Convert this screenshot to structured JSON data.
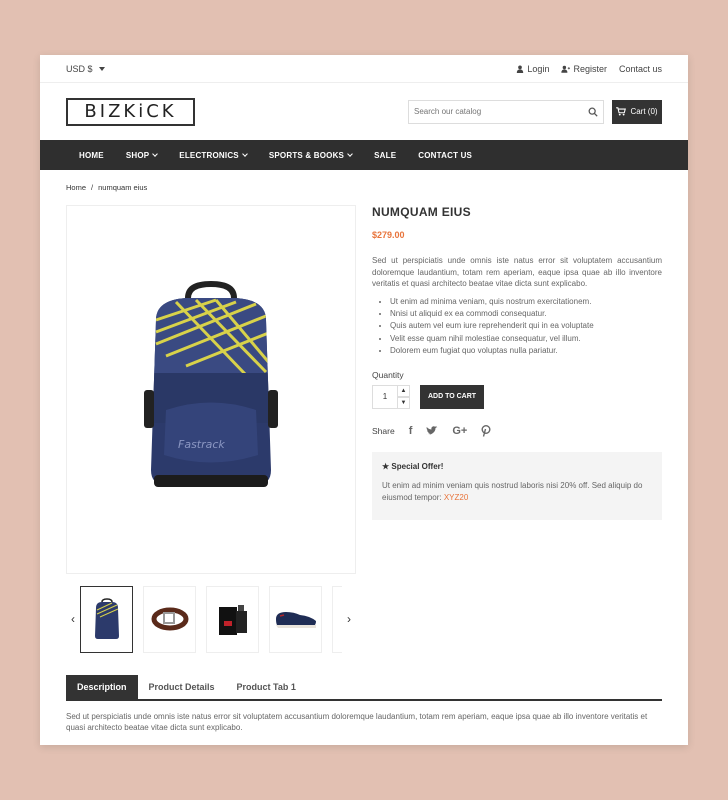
{
  "topbar": {
    "currency": "USD $",
    "login": "Login",
    "register": "Register",
    "contact": "Contact us"
  },
  "header": {
    "logo": "BIZKiCK",
    "search_placeholder": "Search our catalog",
    "cart": "Cart (0)"
  },
  "nav": {
    "items": [
      {
        "label": "HOME",
        "dropdown": false
      },
      {
        "label": "SHOP",
        "dropdown": true
      },
      {
        "label": "ELECTRONICS",
        "dropdown": true
      },
      {
        "label": "SPORTS & BOOKS",
        "dropdown": true
      },
      {
        "label": "SALE",
        "dropdown": false
      },
      {
        "label": "CONTACT US",
        "dropdown": false
      }
    ]
  },
  "breadcrumb": {
    "home": "Home",
    "separator": "/",
    "current": "numquam eius"
  },
  "product": {
    "title": "NUMQUAM EIUS",
    "price": "$279.00",
    "description": "Sed ut perspiciatis unde omnis iste natus error sit voluptatem accusantium doloremque laudantium, totam rem aperiam, eaque ipsa quae ab illo inventore veritatis et quasi architecto beatae vitae dicta sunt explicabo.",
    "bullets": [
      "Ut enim ad minima veniam, quis nostrum exercitationem.",
      "Nnisi ut aliquid ex ea commodi consequatur.",
      "Quis autem vel eum iure reprehenderit qui in ea voluptate",
      "Velit esse quam nihil molestiae consequatur, vel illum.",
      "Dolorem eum fugiat quo voluptas nulla pariatur."
    ],
    "quantity_label": "Quantity",
    "quantity_value": "1",
    "add_to_cart": "ADD TO CART",
    "share_label": "Share",
    "share_icons": [
      "facebook-icon",
      "twitter-icon",
      "google-plus-icon",
      "pinterest-icon"
    ]
  },
  "offer": {
    "title": "Special Offer!",
    "text": "Ut enim ad minim veniam quis nostrud laboris nisi 20% off. Sed aliquip do eiusmod tempor: ",
    "code": "XYZ20"
  },
  "thumbnails": [
    "backpack",
    "belt",
    "perfume",
    "shoe"
  ],
  "tabs": {
    "items": [
      "Description",
      "Product Details",
      "Product Tab 1"
    ],
    "active": 0,
    "content": "Sed ut perspiciatis unde omnis iste natus error sit voluptatem accusantium doloremque laudantium, totam rem aperiam, eaque ipsa quae ab illo inventore veritatis et quasi architecto beatae vitae dicta sunt explicabo."
  },
  "colors": {
    "accent": "#e8743b",
    "dark": "#2f2f2f",
    "background": "#e2c0b2"
  }
}
